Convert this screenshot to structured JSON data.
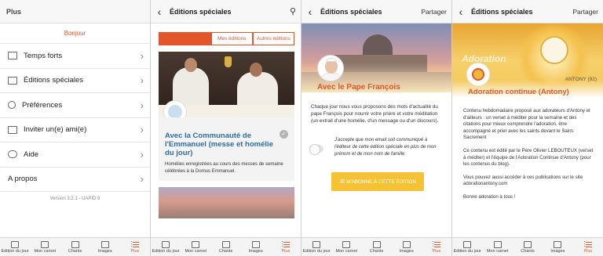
{
  "colors": {
    "accent": "#e2562a",
    "title_blue": "#2d6ea7",
    "cta_yellow": "#f5c234"
  },
  "tabbar": [
    {
      "label": "Edition du jour",
      "icon": "newspaper-icon"
    },
    {
      "label": "Mon carnet",
      "icon": "notebook-icon"
    },
    {
      "label": "Chants",
      "icon": "music-icon"
    },
    {
      "label": "Images",
      "icon": "image-icon"
    },
    {
      "label": "Plus",
      "icon": "more-list-icon"
    }
  ],
  "screen1": {
    "title": "Plus",
    "greeting": "Bonjour",
    "menu": [
      {
        "label": "Temps forts",
        "icon": "grid-list-icon"
      },
      {
        "label": "Éditions spéciales",
        "icon": "card-icon"
      },
      {
        "label": "Préférences",
        "icon": "user-icon"
      },
      {
        "label": "Inviter un(e) ami(e)",
        "icon": "gift-icon"
      },
      {
        "label": "Aide",
        "icon": "chat-icon"
      },
      {
        "label": "A propos",
        "icon": ""
      }
    ],
    "version": "Version 3.2.1 - UAPID 9"
  },
  "screen2": {
    "title": "Éditions spéciales",
    "segments": [
      "",
      "Mes éditions",
      "Autres éditions"
    ],
    "card": {
      "title": "Avec la Communauté de l'Emmanuel (messe et homélie du jour)",
      "description": "Homélies enregistrées au cours des messes de semaine célébrées à la Domus Emmanuel."
    }
  },
  "screen3": {
    "title": "Éditions spéciales",
    "action": "Partager",
    "hero_title": "Avec le Pape François",
    "intro": "Chaque jour nous vous proposons des mots d'actualité du pape François pour nourrir votre prière et votre méditation (un extrait d'une homélie, d'un message ou d'un discours).",
    "consent": "J'accepte que mon email soit communiqué à l'éditeur de cette édition spéciale en plus de mon prénom et de mon nom de famille",
    "subscribe": "JE M'ABONNE À CETTE ÉDITION"
  },
  "screen4": {
    "title": "Éditions spéciales",
    "action": "Partager",
    "hero_word": "Adoration",
    "author": "ANTONY (92)",
    "hero_title": "Adoration continue (Antony)",
    "paragraphs": [
      "Contenu hebdomadaire proposé aux adorateurs d'Antony et d'ailleurs : un verset à méditer pour la semaine et des citations pour mieux comprendre l'adoration, être accompagné et prier avec les saints devant le Saint-Sacrement",
      "Ce contenu est édité par le Père Olivier LEBOUTEUX (verset à méditer) et l'équipe de l'Adoration Continue d'Antony (pour les contenus du blog).",
      "Vous pouvez aussi accéder à ces publications sur le site adorationantony.com",
      "Bonne adoration à tous !"
    ]
  }
}
